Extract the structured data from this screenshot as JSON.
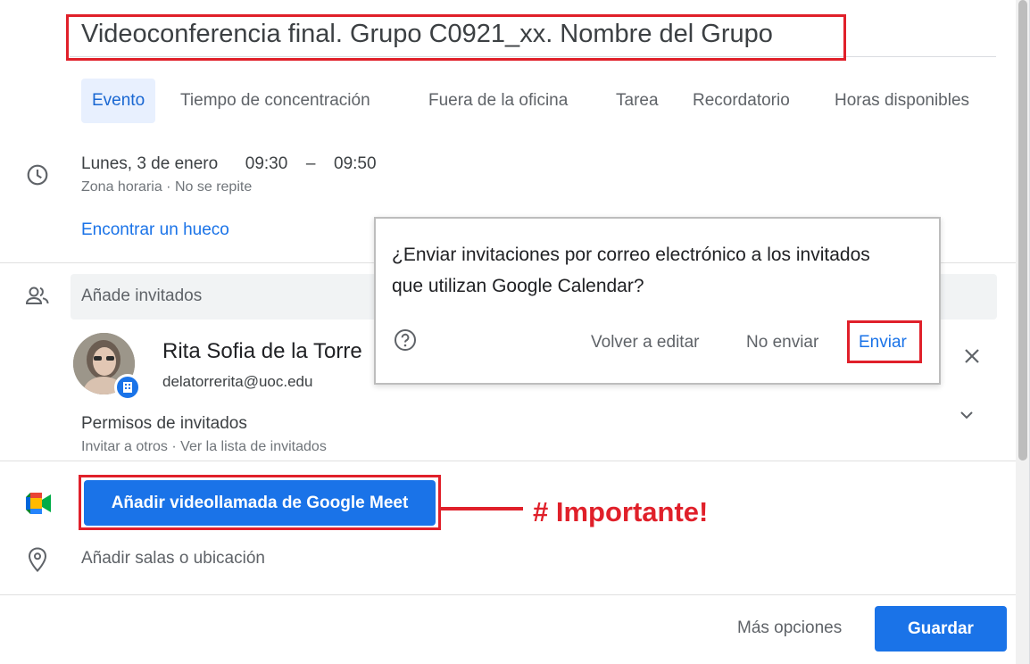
{
  "event": {
    "title": "Videoconferencia final. Grupo C0921_xx. Nombre del Grupo",
    "tabs": [
      "Evento",
      "Tiempo de concentración",
      "Fuera de la oficina",
      "Tarea",
      "Recordatorio",
      "Horas disponibles"
    ],
    "date": "Lunes, 3 de enero",
    "start": "09:30",
    "dash": "–",
    "end": "09:50",
    "timezone": "Zona horaria",
    "repeat": "No se repite",
    "find_slot": "Encontrar un hueco"
  },
  "guests": {
    "placeholder": "Añade invitados",
    "guest_name": "Rita Sofia de la Torre",
    "guest_email": "delatorrerita@uoc.edu",
    "permissions_title": "Permisos de invitados",
    "invite_others": "Invitar a otros",
    "see_list": "Ver la lista de invitados"
  },
  "meet": {
    "button_label": "Añadir videollamada de Google Meet",
    "annotation": "# Importante!"
  },
  "location": {
    "placeholder": "Añadir salas o ubicación"
  },
  "footer": {
    "more_options": "Más opciones",
    "save": "Guardar"
  },
  "dialog": {
    "message": "¿Enviar invitaciones por correo electrónico a los invitados que utilizan Google Calendar?",
    "edit_again": "Volver a editar",
    "dont_send": "No enviar",
    "send": "Enviar"
  },
  "icons": {
    "clock": "clock-icon",
    "people": "people-icon",
    "meet": "google-meet-icon",
    "location": "location-pin-icon",
    "help": "help-circle-icon",
    "close": "close-icon",
    "chevron": "chevron-down-icon"
  },
  "colors": {
    "accent": "#1a73e8",
    "annotation_red": "#e0202a",
    "active_tab_bg": "#e8f0fe"
  }
}
